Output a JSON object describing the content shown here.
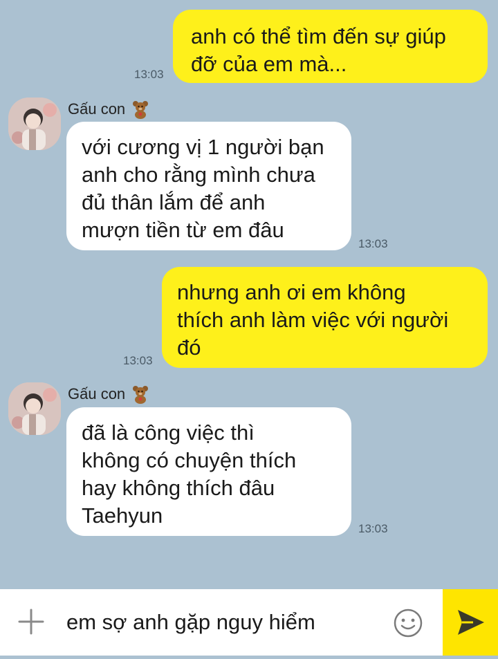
{
  "messages": [
    {
      "direction": "out",
      "text": "anh có thể tìm đến sự giúp\nđỡ của em mà...",
      "time": "13:03"
    },
    {
      "direction": "in",
      "sender": "Gấu con",
      "text": "với cương vị 1 người bạn\nanh cho rằng mình chưa\nđủ thân lắm để anh\nmượn tiền từ em đâu",
      "time": "13:03"
    },
    {
      "direction": "out",
      "text": "nhưng anh ơi em không\nthích anh làm việc với người\nđó",
      "time": "13:03"
    },
    {
      "direction": "in",
      "sender": "Gấu con",
      "text": "đã là công việc thì\nkhông có chuyện thích\nhay không thích đâu\nTaehyun",
      "time": "13:03"
    }
  ],
  "sender_icon": "teddy-bear-emoji",
  "input": {
    "value": "em sợ anh gặp nguy hiểm"
  },
  "icons": {
    "attach": "plus-icon",
    "emoji": "smiley-icon",
    "send": "send-arrow-icon"
  },
  "colors": {
    "background": "#abc1d1",
    "outgoing_bubble": "#fef01b",
    "incoming_bubble": "#ffffff",
    "send_button": "#fee500"
  }
}
